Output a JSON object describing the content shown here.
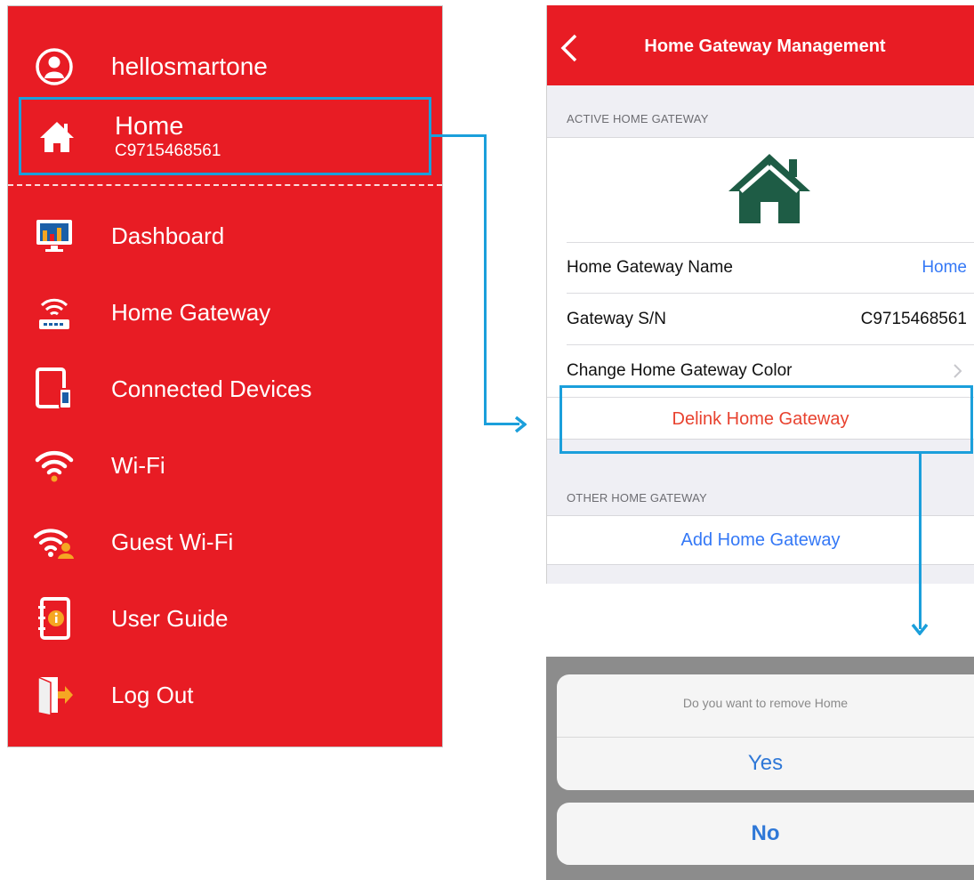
{
  "menu": {
    "username": "hellosmartone",
    "home": {
      "name": "Home",
      "serial": "C9715468561"
    },
    "items": [
      {
        "label": "Dashboard",
        "icon": "dashboard-icon"
      },
      {
        "label": "Home Gateway",
        "icon": "router-icon"
      },
      {
        "label": "Connected Devices",
        "icon": "devices-icon"
      },
      {
        "label": "Wi-Fi",
        "icon": "wifi-icon"
      },
      {
        "label": "Guest Wi-Fi",
        "icon": "guest-wifi-icon"
      },
      {
        "label": "User Guide",
        "icon": "user-guide-icon"
      },
      {
        "label": "Log Out",
        "icon": "logout-icon"
      }
    ]
  },
  "gateway_screen": {
    "title": "Home Gateway Management",
    "active_section": "ACTIVE HOME GATEWAY",
    "rows": {
      "name_label": "Home Gateway Name",
      "name_value": "Home",
      "sn_label": "Gateway S/N",
      "sn_value": "C9715468561",
      "color_label": "Change Home Gateway Color"
    },
    "delink_label": "Delink Home Gateway",
    "other_section": "OTHER HOME GATEWAY",
    "add_label": "Add Home Gateway"
  },
  "alert": {
    "message": "Do you want to remove Home",
    "yes_label": "Yes",
    "no_label": "No"
  },
  "colors": {
    "brand_red": "#e81c24",
    "highlight_blue": "#1b9fdb",
    "link_blue": "#3478f6",
    "gateway_green": "#1e5c45",
    "destructive_red": "#e8422f"
  }
}
